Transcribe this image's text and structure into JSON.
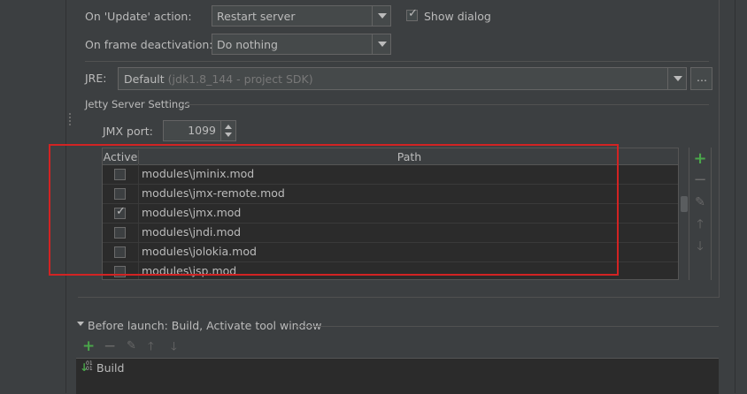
{
  "update_action": {
    "label": "On 'Update' action:",
    "value": "Restart server",
    "show_dialog_label": "Show dialog",
    "show_dialog_checked": true
  },
  "frame_deactivation": {
    "label": "On frame deactivation:",
    "value": "Do nothing"
  },
  "jre": {
    "label": "JRE:",
    "value": "Default",
    "hint": "(jdk1.8_144 - project SDK)",
    "browse_label": "..."
  },
  "jetty_settings": {
    "title": "Jetty Server Settings",
    "jmx_port_label": "JMX port:",
    "jmx_port_value": "1099",
    "table": {
      "headers": [
        "Active",
        "Path"
      ],
      "rows": [
        {
          "active": false,
          "path": "modules\\jminix.mod"
        },
        {
          "active": false,
          "path": "modules\\jmx-remote.mod"
        },
        {
          "active": true,
          "path": "modules\\jmx.mod"
        },
        {
          "active": false,
          "path": "modules\\jndi.mod"
        },
        {
          "active": false,
          "path": "modules\\jolokia.mod"
        },
        {
          "active": false,
          "path": "modules\\jsp.mod"
        }
      ]
    },
    "tools": [
      "add-icon",
      "remove-icon",
      "edit-icon",
      "move-up-icon",
      "move-down-icon"
    ]
  },
  "before_launch": {
    "title": "Before launch: Build, Activate tool window",
    "items": [
      {
        "label": "Build"
      }
    ]
  },
  "colors": {
    "background": "#3c3f41",
    "table_bg": "#2b2b2b",
    "highlight_frame": "#d22323",
    "add_green": "#4aa64a"
  }
}
